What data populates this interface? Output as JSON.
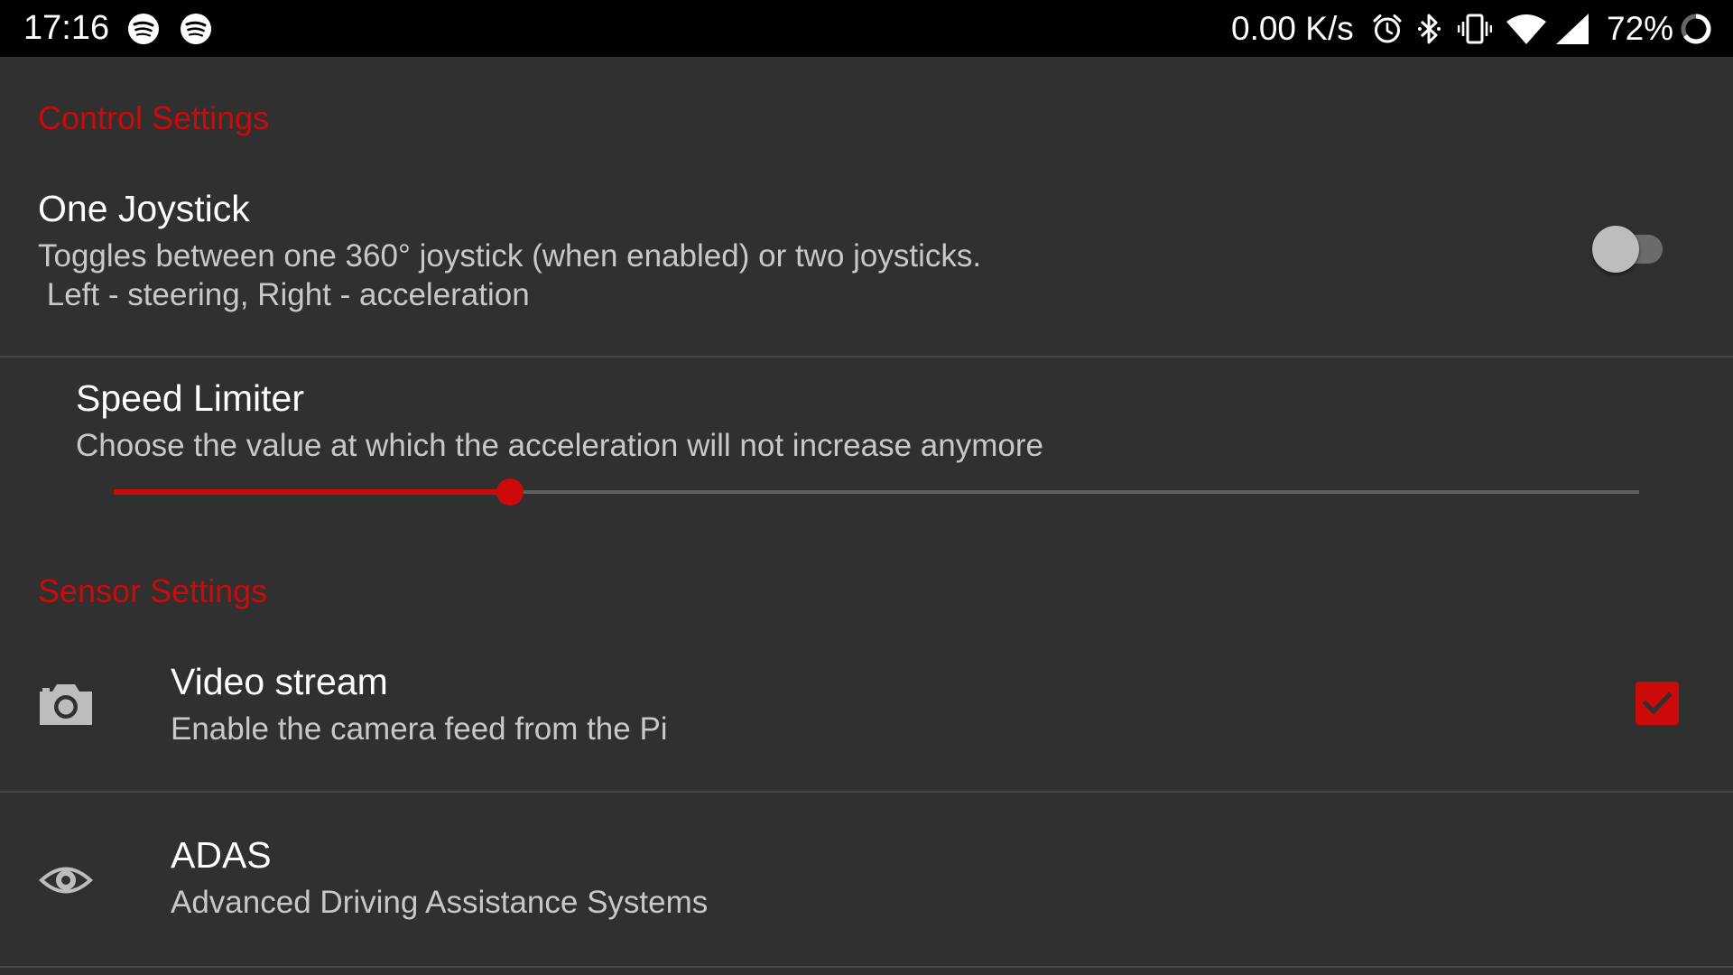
{
  "status_bar": {
    "time": "17:16",
    "left_icons": [
      "spotify-icon",
      "spotify-icon"
    ],
    "network_speed": "0.00 K/s",
    "right_icons": [
      "alarm-icon",
      "bluetooth-icon",
      "vibrate-icon",
      "wifi-icon",
      "cell-signal-icon"
    ],
    "battery_percent": "72%"
  },
  "control_settings": {
    "title": "Control Settings",
    "one_joystick": {
      "title": "One Joystick",
      "summary_line1": "Toggles between one 360° joystick (when enabled) or two joysticks.",
      "summary_line2": " Left - steering, Right - acceleration",
      "enabled": false
    },
    "speed_limiter": {
      "title": "Speed Limiter",
      "summary": "Choose the value at which the acceleration will not increase anymore",
      "value_fraction": 0.26
    }
  },
  "sensor_settings": {
    "title": "Sensor Settings",
    "video_stream": {
      "icon": "camera-icon",
      "title": "Video stream",
      "summary": "Enable the camera feed from the Pi",
      "checked": true
    },
    "adas": {
      "icon": "eye-icon",
      "title": "ADAS",
      "summary": "Advanced Driving Assistance Systems"
    }
  },
  "colors": {
    "accent": "#cc0a0a",
    "background": "#303030",
    "status_bar": "#000000"
  }
}
